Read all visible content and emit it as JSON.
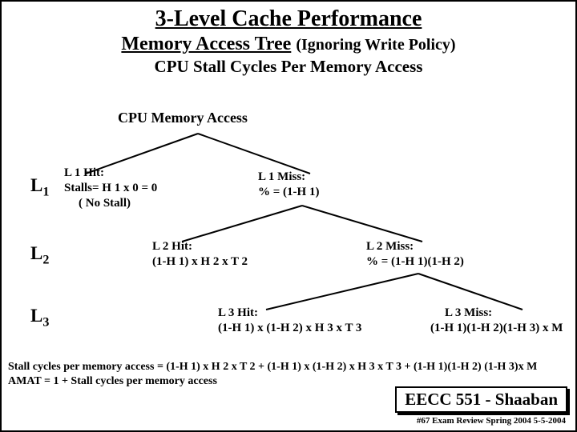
{
  "title": "3-Level Cache Performance",
  "subtitle_main": "Memory Access Tree",
  "subtitle_paren": "(Ignoring Write Policy)",
  "line3": "CPU  Stall Cycles Per Memory Access",
  "root": "CPU Memory  Access",
  "levels": {
    "l1": "L",
    "l1s": "1",
    "l2": "L",
    "l2s": "2",
    "l3": "L",
    "l3s": "3"
  },
  "l1hit_l1": "L 1  Hit:",
  "l1hit_l2": "Stalls= H 1 x 0 = 0",
  "l1hit_l3": "( No Stall)",
  "l1miss_l1": "L 1  Miss:",
  "l1miss_l2": "  %  =  (1-H 1)",
  "l2hit_l1": "L 2  Hit:",
  "l2hit_l2": "(1-H 1) x H 2 x T 2",
  "l2miss_l1": "L 2   Miss:",
  "l2miss_l2": "  %   =    (1-H 1)(1-H 2)",
  "l3hit_l1": "L 3  Hit:",
  "l3hit_l2": "(1-H 1) x (1-H 2) x H 3 x  T 3",
  "l3miss_l1": "L 3   Miss:",
  "l3miss_l2": "(1-H 1)(1-H 2)(1-H 3)  x M",
  "bottom1": "Stall cycles per memory access   =   (1-H 1) x H 2 x T 2  +  (1-H 1) x (1-H 2) x H 3 x T 3   + (1-H 1)(1-H 2) (1-H 3)x M",
  "bottom2": "AMAT  =   1  + Stall cycles per memory access",
  "course": "EECC 551 - Shaaban",
  "footnote": "#67  Exam Review  Spring 2004  5-5-2004"
}
